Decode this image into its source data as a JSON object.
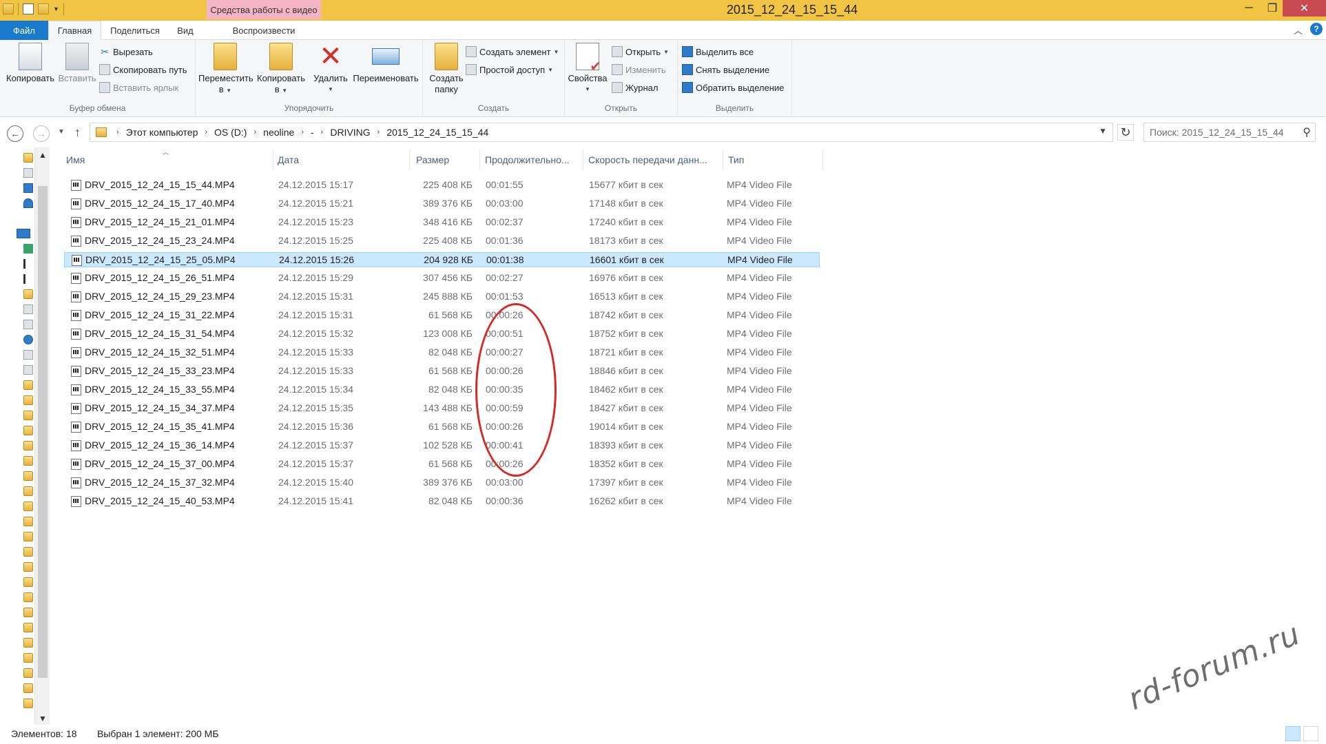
{
  "window": {
    "title": "2015_12_24_15_15_44",
    "contextual_tab_header": "Средства работы с видео"
  },
  "tabs": {
    "file": "Файл",
    "home": "Главная",
    "share": "Поделиться",
    "view": "Вид",
    "play": "Воспроизвести"
  },
  "ribbon": {
    "clipboard": {
      "label": "Буфер обмена",
      "copy": "Копировать",
      "paste": "Вставить",
      "cut": "Вырезать",
      "copy_path": "Скопировать путь",
      "paste_shortcut": "Вставить ярлык"
    },
    "organize": {
      "label": "Упорядочить",
      "move_to_line1": "Переместить",
      "move_to_line2": "в",
      "copy_to_line1": "Копировать",
      "copy_to_line2": "в",
      "delete": "Удалить",
      "rename": "Переименовать"
    },
    "create": {
      "label": "Создать",
      "new_folder_line1": "Создать",
      "new_folder_line2": "папку",
      "new_item": "Создать элемент",
      "easy_access": "Простой доступ"
    },
    "open": {
      "label": "Открыть",
      "properties": "Свойства",
      "open": "Открыть",
      "edit": "Изменить",
      "history": "Журнал"
    },
    "select": {
      "label": "Выделить",
      "select_all": "Выделить все",
      "select_none": "Снять выделение",
      "invert_selection": "Обратить выделение"
    }
  },
  "address": {
    "crumbs": [
      "Этот компьютер",
      "OS (D:)",
      "neoline",
      "-",
      "DRIVING",
      "2015_12_24_15_15_44"
    ],
    "search_placeholder": "Поиск: 2015_12_24_15_15_44"
  },
  "columns": {
    "name": "Имя",
    "date": "Дата",
    "size": "Размер",
    "duration": "Продолжительно...",
    "bitrate": "Скорость передачи данн...",
    "type": "Тип"
  },
  "files": [
    {
      "name": "DRV_2015_12_24_15_15_44.MP4",
      "date": "24.12.2015 15:17",
      "size": "225 408 КБ",
      "duration": "00:01:55",
      "bitrate": "15677 кбит в сек",
      "type": "MP4 Video File"
    },
    {
      "name": "DRV_2015_12_24_15_17_40.MP4",
      "date": "24.12.2015 15:21",
      "size": "389 376 КБ",
      "duration": "00:03:00",
      "bitrate": "17148 кбит в сек",
      "type": "MP4 Video File"
    },
    {
      "name": "DRV_2015_12_24_15_21_01.MP4",
      "date": "24.12.2015 15:23",
      "size": "348 416 КБ",
      "duration": "00:02:37",
      "bitrate": "17240 кбит в сек",
      "type": "MP4 Video File"
    },
    {
      "name": "DRV_2015_12_24_15_23_24.MP4",
      "date": "24.12.2015 15:25",
      "size": "225 408 КБ",
      "duration": "00:01:36",
      "bitrate": "18173 кбит в сек",
      "type": "MP4 Video File"
    },
    {
      "name": "DRV_2015_12_24_15_25_05.MP4",
      "date": "24.12.2015 15:26",
      "size": "204 928 КБ",
      "duration": "00:01:38",
      "bitrate": "16601 кбит в сек",
      "type": "MP4 Video File",
      "selected": true
    },
    {
      "name": "DRV_2015_12_24_15_26_51.MP4",
      "date": "24.12.2015 15:29",
      "size": "307 456 КБ",
      "duration": "00:02:27",
      "bitrate": "16976 кбит в сек",
      "type": "MP4 Video File"
    },
    {
      "name": "DRV_2015_12_24_15_29_23.MP4",
      "date": "24.12.2015 15:31",
      "size": "245 888 КБ",
      "duration": "00:01:53",
      "bitrate": "16513 кбит в сек",
      "type": "MP4 Video File"
    },
    {
      "name": "DRV_2015_12_24_15_31_22.MP4",
      "date": "24.12.2015 15:31",
      "size": "61 568 КБ",
      "duration": "00:00:26",
      "bitrate": "18742 кбит в сек",
      "type": "MP4 Video File"
    },
    {
      "name": "DRV_2015_12_24_15_31_54.MP4",
      "date": "24.12.2015 15:32",
      "size": "123 008 КБ",
      "duration": "00:00:51",
      "bitrate": "18752 кбит в сек",
      "type": "MP4 Video File"
    },
    {
      "name": "DRV_2015_12_24_15_32_51.MP4",
      "date": "24.12.2015 15:33",
      "size": "82 048 КБ",
      "duration": "00:00:27",
      "bitrate": "18721 кбит в сек",
      "type": "MP4 Video File"
    },
    {
      "name": "DRV_2015_12_24_15_33_23.MP4",
      "date": "24.12.2015 15:33",
      "size": "61 568 КБ",
      "duration": "00:00:26",
      "bitrate": "18846 кбит в сек",
      "type": "MP4 Video File"
    },
    {
      "name": "DRV_2015_12_24_15_33_55.MP4",
      "date": "24.12.2015 15:34",
      "size": "82 048 КБ",
      "duration": "00:00:35",
      "bitrate": "18462 кбит в сек",
      "type": "MP4 Video File"
    },
    {
      "name": "DRV_2015_12_24_15_34_37.MP4",
      "date": "24.12.2015 15:35",
      "size": "143 488 КБ",
      "duration": "00:00:59",
      "bitrate": "18427 кбит в сек",
      "type": "MP4 Video File"
    },
    {
      "name": "DRV_2015_12_24_15_35_41.MP4",
      "date": "24.12.2015 15:36",
      "size": "61 568 КБ",
      "duration": "00:00:26",
      "bitrate": "19014 кбит в сек",
      "type": "MP4 Video File"
    },
    {
      "name": "DRV_2015_12_24_15_36_14.MP4",
      "date": "24.12.2015 15:37",
      "size": "102 528 КБ",
      "duration": "00:00:41",
      "bitrate": "18393 кбит в сек",
      "type": "MP4 Video File"
    },
    {
      "name": "DRV_2015_12_24_15_37_00.MP4",
      "date": "24.12.2015 15:37",
      "size": "61 568 КБ",
      "duration": "00:00:26",
      "bitrate": "18352 кбит в сек",
      "type": "MP4 Video File"
    },
    {
      "name": "DRV_2015_12_24_15_37_32.MP4",
      "date": "24.12.2015 15:40",
      "size": "389 376 КБ",
      "duration": "00:03:00",
      "bitrate": "17397 кбит в сек",
      "type": "MP4 Video File"
    },
    {
      "name": "DRV_2015_12_24_15_40_53.MP4",
      "date": "24.12.2015 15:41",
      "size": "82 048 КБ",
      "duration": "00:00:36",
      "bitrate": "16262 кбит в сек",
      "type": "MP4 Video File"
    }
  ],
  "status": {
    "count": "Элементов: 18",
    "selected": "Выбран 1 элемент: 200 МБ"
  },
  "watermark": "rd-forum.ru",
  "colors": {
    "titlebar": "#f2c443",
    "contextual_tab": "#f4b4c5",
    "file_tab": "#1979ca",
    "selection": "#cce8ff",
    "annotation": "#d42a2a"
  }
}
